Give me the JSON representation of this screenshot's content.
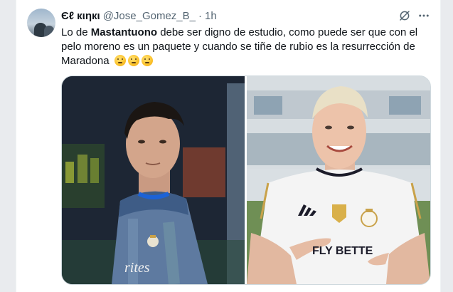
{
  "tweet": {
    "display_name": "Єℓ кιηкι",
    "handle": "@Jose_Gomez_B_",
    "separator": "·",
    "time": "1h",
    "text_parts": {
      "prefix": "Lo de ",
      "bold": "Mastantuono",
      "suffix": " debe ser digno de estudio, como puede ser que con el pelo moreno es un paquete y cuando se tiñe de rubio es la resurrección de Maradona"
    },
    "emojis": [
      "thinking-face",
      "thinking-face",
      "thinking-face"
    ],
    "icons": {
      "grok": "grok-icon",
      "more": "more-icon"
    }
  },
  "media": {
    "left_photo": {
      "jersey_text": "rites"
    },
    "right_photo": {
      "jersey_text": "FLY BETTE"
    }
  },
  "colors": {
    "text": "#0f1419",
    "muted": "#536471",
    "border": "#cfd9de",
    "real_madrid_gold": "#c9a24a"
  }
}
